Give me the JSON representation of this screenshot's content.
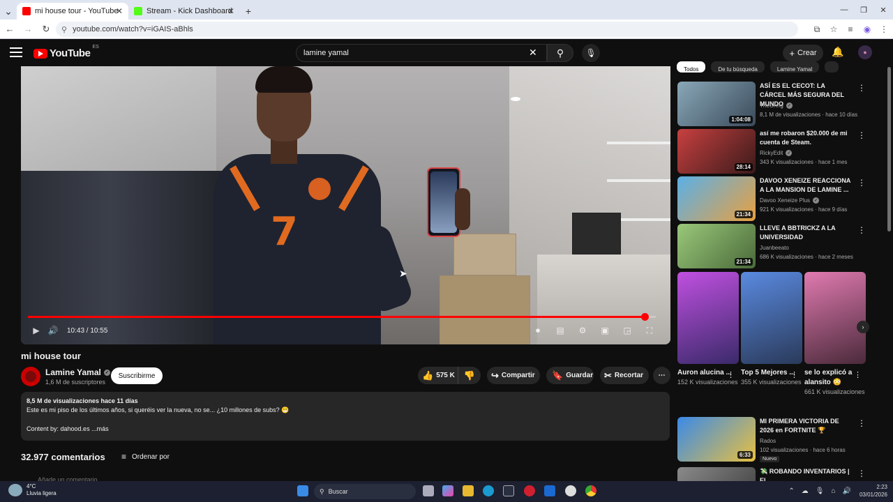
{
  "browser": {
    "tabs": [
      {
        "label": "mi house tour - YouTube",
        "active": true,
        "favicon_color": "#ff0000"
      },
      {
        "label": "Stream - Kick Dashboard",
        "active": false,
        "favicon_color": "#53fc18"
      }
    ],
    "url": "youtube.com/watch?v=iGAIS-aBhls"
  },
  "header": {
    "logo_text": "YouTube",
    "region": "ES",
    "search_value": "lamine yamal",
    "create_label": "Crear"
  },
  "player": {
    "time_current": "10:43",
    "time_total": "10:55",
    "time_display": "10:43 / 10:55",
    "progress": 0.982,
    "jersey_number": "7"
  },
  "video": {
    "title": "mi house tour",
    "channel": "Lamine Yamal",
    "subscribers": "1,6 M de suscriptores",
    "subscribe_label": "Suscribirme",
    "likes": "575 K",
    "share_label": "Compartir",
    "save_label": "Guardar",
    "clip_label": "Recortar",
    "description": {
      "meta": "8,5 M de visualizaciones  hace 11 días",
      "line1": "Este es mi piso de los últimos años, si queréis ver la nueva, no se... ¿10 millones de subs? 😁",
      "line2": "Content by: dahood.es ...más"
    }
  },
  "comments": {
    "count": "32.977 comentarios",
    "sort_label": "Ordenar por",
    "add_placeholder": "Añade un comentario..."
  },
  "sidebar": {
    "chips": [
      "Todos",
      "De tu búsqueda",
      "Lamine Yamal",
      ""
    ],
    "recommendations": [
      {
        "title": "ASÍ ES EL CECOT: LA CÁRCEL MÁS SEGURA DEL MUNDO",
        "channel": "TheGrefg",
        "verified": true,
        "stats": "8,1 M de visualizaciones · hace 10 días",
        "duration": "1:04:08",
        "thumb_color": "#6a8a9a"
      },
      {
        "title": "así me robaron $20.000 de mi cuenta de Steam.",
        "channel": "RickyEdit",
        "verified": true,
        "stats": "343 K visualizaciones · hace 1 mes",
        "duration": "28:14",
        "thumb_color": "#8a2a2a"
      },
      {
        "title": "DAVOO XENEIZE REACCIONA A LA MANSION DE LAMINE ...",
        "channel": "Davoo Xeneize Plus",
        "verified": true,
        "stats": "921 K visualizaciones · hace 9 días",
        "duration": "21:34",
        "thumb_color": "#3a8ac8"
      },
      {
        "title": "LLEVE A BBTRICKZ A LA UNIVERSIDAD",
        "channel": "Juanbeeato",
        "verified": false,
        "stats": "686 K visualizaciones · hace 2 meses",
        "duration": "21:34",
        "thumb_color": "#7aaa5a"
      }
    ],
    "shorts": [
      {
        "title": "Auron alucina ...",
        "views": "152 K visualizaciones",
        "thumb_color": "#a040c0"
      },
      {
        "title": "Top 5 Mejores ...",
        "views": "355 K visualizaciones",
        "thumb_color": "#4a7ac0"
      },
      {
        "title": "se lo explicó a alansito 😳",
        "views": "661 K visualizaciones",
        "thumb_color": "#c06a9a"
      }
    ],
    "more": [
      {
        "title": "MI PRIMERA VICTORIA DE 2026 en FORTNITE 🏆",
        "channel": "Rados",
        "stats": "102 visualizaciones · hace 6 horas",
        "duration": "6:33",
        "badge": "Nuevo",
        "thumb_color": "#2a6ac8"
      },
      {
        "title": "💸 ROBANDO INVENTARIOS | El...",
        "channel": "",
        "stats": "",
        "duration": "",
        "thumb_color": "#6a6a6a"
      }
    ]
  },
  "taskbar": {
    "temp": "4°C",
    "weather": "Lluvia ligera",
    "search": "Buscar",
    "time": "2:23",
    "date": "03/01/2026"
  }
}
